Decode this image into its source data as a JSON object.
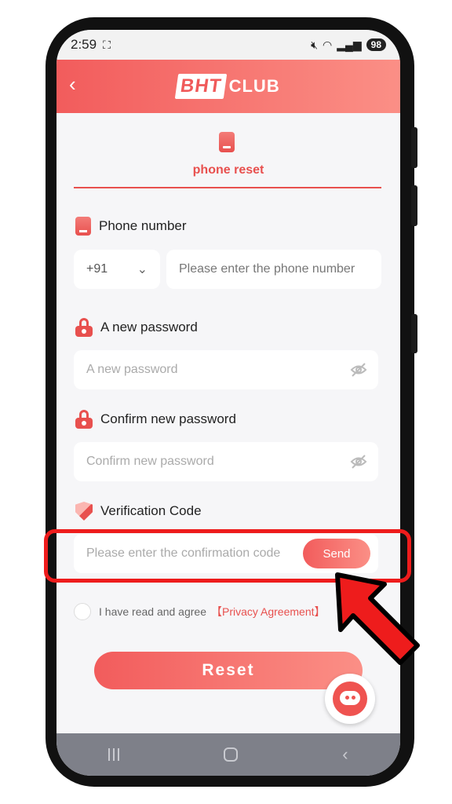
{
  "status_bar": {
    "time": "2:59",
    "battery": "98"
  },
  "header": {
    "back_icon": "chevron-left-icon",
    "logo_box": "BHT",
    "logo_text": "CLUB"
  },
  "tab": {
    "label": "phone reset"
  },
  "phone_section": {
    "label": "Phone number",
    "country_code": "+91",
    "placeholder": "Please enter the phone number"
  },
  "new_password_section": {
    "label": "A new password",
    "placeholder": "A new password"
  },
  "confirm_password_section": {
    "label": "Confirm new password",
    "placeholder": "Confirm new password"
  },
  "verification_section": {
    "label": "Verification Code",
    "placeholder": "Please enter the confirmation code",
    "send_label": "Send"
  },
  "agreement": {
    "text": "I have read and agree",
    "link": "【Privacy Agreement】"
  },
  "reset_label": "Reset",
  "colors": {
    "accent": "#e8504e",
    "highlight": "#ee1c1c",
    "navbar": "#7e8089"
  }
}
